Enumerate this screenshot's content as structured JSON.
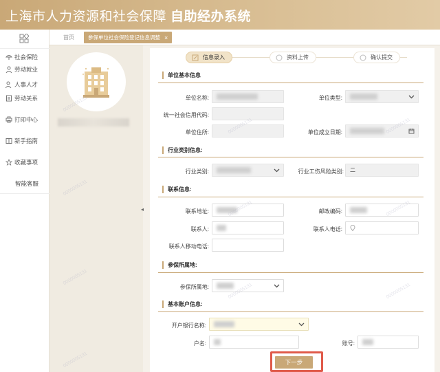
{
  "header": {
    "title_main": "上海市人力资源和社会保障",
    "title_sub": "自助经办系统"
  },
  "sidebar": {
    "items": [
      {
        "label": "社会保险",
        "icon": "umbrella-icon"
      },
      {
        "label": "劳动就业",
        "icon": "person-icon"
      },
      {
        "label": "人事人才",
        "icon": "people-icon"
      },
      {
        "label": "劳动关系",
        "icon": "document-icon"
      },
      {
        "label": "打印中心",
        "icon": "printer-icon"
      },
      {
        "label": "新手指南",
        "icon": "book-icon"
      },
      {
        "label": "收藏事项",
        "icon": "star-icon"
      },
      {
        "label": "智能客服",
        "icon": ""
      }
    ]
  },
  "tabs": {
    "home": "首页",
    "active": "参保单位社会保险登记信息调整",
    "close": "×"
  },
  "steps": [
    "信息录入",
    "资料上传",
    "确认提交"
  ],
  "sections": {
    "basic": "单位基本信息",
    "industry": "行业类别信息:",
    "contact": "联系信息:",
    "insured": "参保所属地:",
    "account": "基本账户信息:"
  },
  "fields": {
    "unit_name": "单位名称:",
    "unit_type": "单位类型:",
    "credit_code": "统一社会信用代码:",
    "unit_address": "单位住所:",
    "established": "单位成立日期:",
    "industry_type": "行业类别:",
    "risk_type": "行业工伤风险类别:",
    "risk_value": "二",
    "contact_address": "联系地址:",
    "postcode": "邮政编码:",
    "contact_person": "联系人:",
    "contact_phone": "联系人电话:",
    "contact_mobile": "联系人移动电话:",
    "insured_place": "参保所属地:",
    "bank_name": "开户银行名称:",
    "account_name": "户名:",
    "account_no": "账号:"
  },
  "next_button": "下一步",
  "watermark": "0000005131"
}
